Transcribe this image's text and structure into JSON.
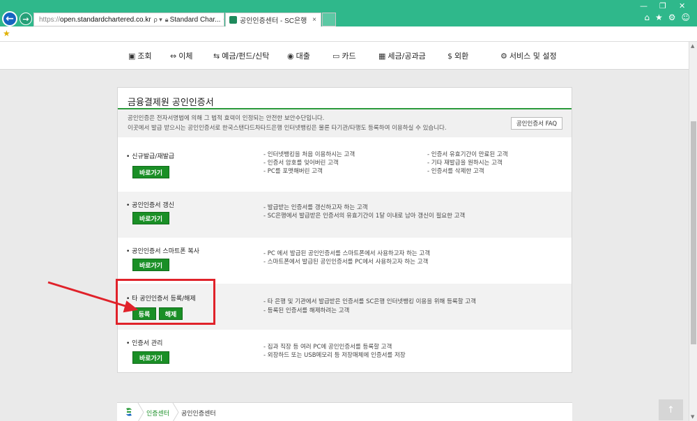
{
  "browser": {
    "url_prefix": "https://",
    "url_host": "open.standardchartered.co.kr",
    "url_search": "ρ ▾",
    "site_label": "Standard Char...",
    "reload": "C",
    "tab_title": "공인인증센터 - SC은행",
    "tab_close": "×"
  },
  "topnav": [
    {
      "icon": "▣",
      "label": "조회"
    },
    {
      "icon": "⇔",
      "label": "이체"
    },
    {
      "icon": "⇆",
      "label": "예금/펀드/신탁"
    },
    {
      "icon": "◉",
      "label": "대출"
    },
    {
      "icon": "▭",
      "label": "카드"
    },
    {
      "icon": "▦",
      "label": "세금/공과금"
    },
    {
      "icon": "$",
      "label": "외환"
    },
    {
      "icon": "⚙",
      "label": "서비스 및 설정"
    }
  ],
  "panel": {
    "title": "금융결제원 공인인증서",
    "intro_line1": "공인인증은 전자서명법에 의해 그 법적 효력이 인정되는 안전한 보안수단입니다.",
    "intro_line2": "이곳에서 발급 받으시는 공인인증서로 한국스탠다드차타드은행 인터넷뱅킹은 물론 타기관/타행도 등록하여 이용하실 수 있습니다.",
    "faq_label": "공인인증서 FAQ"
  },
  "rows": [
    {
      "title": "신규발급/재발급",
      "buttons": [
        "바로가기"
      ],
      "desc_left": [
        "- 인터넷뱅킹을 처음 이용하시는 고객",
        "- 인증서 암호를 잊어버린 고객",
        "- PC를 포맷해버린 고객"
      ],
      "desc_right": [
        "- 인증서 유효기간이 만료된 고객",
        "- 기타 재발급을 원하시는 고객",
        "- 인증서를 삭제한 고객"
      ]
    },
    {
      "title": "공인인증서 갱신",
      "buttons": [
        "바로가기"
      ],
      "desc_left": [
        "- 발급받는 인증서를 갱신하고자 하는 고객",
        "- SC은행에서 발급받은 인증서의 유효기간이 1달 이내로 남아 갱신이 필요한 고객"
      ],
      "desc_right": []
    },
    {
      "title": "공인인증서 스마트폰 복사",
      "buttons": [
        "바로가기"
      ],
      "desc_left": [
        "- PC 에서 발급된 공인인증서를 스마트폰에서 사용하고자 하는 고객",
        "- 스마트폰에서 발급된 공인인증서를 PC에서 사용하고자 하는 고객"
      ],
      "desc_right": []
    },
    {
      "title": "타 공인인증서 등록/해제",
      "buttons": [
        "등록",
        "해제"
      ],
      "desc_left": [
        "- 타 은행 및 기관에서 발급받은 인증서를 SC은행 인터넷뱅킹 이용을 위해 등록할 고객",
        "- 등록된 인증서를 해제하려는 고객"
      ],
      "desc_right": []
    },
    {
      "title": "인증서 관리",
      "buttons": [
        "바로가기"
      ],
      "desc_left": [
        "- 집과 직장 등 여러 PC에 공인인증서를 등록할 고객",
        "- 외장하드 또는 USB메모리 등 저장매체에 인증서를 저장"
      ],
      "desc_right": []
    }
  ],
  "breadcrumb": [
    "인증센터",
    "공인인증센터"
  ],
  "colors": {
    "brand_green": "#1a8f26",
    "highlight_red": "#e0222a",
    "chrome_teal": "#2fb88b"
  }
}
